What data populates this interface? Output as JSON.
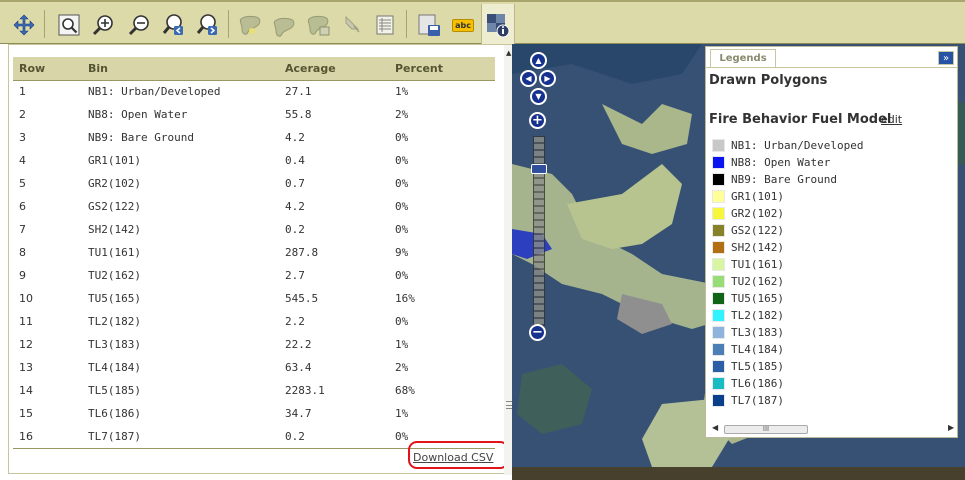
{
  "toolbar": {
    "buttons": [
      {
        "icon": "pan-arrows-icon"
      },
      {
        "icon": "zoom-extent-icon"
      },
      {
        "icon": "zoom-in-icon"
      },
      {
        "icon": "zoom-out-icon"
      },
      {
        "icon": "zoom-previous-icon"
      },
      {
        "icon": "zoom-next-icon"
      },
      {
        "icon": "draw-polygon-icon"
      },
      {
        "icon": "edit-polygon-icon"
      },
      {
        "icon": "polygon-table-icon"
      },
      {
        "icon": "select-arrow-icon"
      },
      {
        "icon": "attribute-table-icon"
      },
      {
        "icon": "save-map-icon"
      },
      {
        "icon": "label-abc-icon"
      },
      {
        "icon": "map-info-icon"
      }
    ],
    "label_icon_text": "abc"
  },
  "table": {
    "headers": [
      "Row",
      "Bin",
      "Acerage",
      "Percent"
    ],
    "rows": [
      {
        "row": "1",
        "bin": "NB1: Urban/Developed",
        "acreage": "27.1",
        "percent": "1%"
      },
      {
        "row": "2",
        "bin": "NB8: Open Water",
        "acreage": "55.8",
        "percent": "2%"
      },
      {
        "row": "3",
        "bin": "NB9: Bare Ground",
        "acreage": "4.2",
        "percent": "0%"
      },
      {
        "row": "4",
        "bin": "GR1(101)",
        "acreage": "0.4",
        "percent": "0%"
      },
      {
        "row": "5",
        "bin": "GR2(102)",
        "acreage": "0.7",
        "percent": "0%"
      },
      {
        "row": "6",
        "bin": "GS2(122)",
        "acreage": "4.2",
        "percent": "0%"
      },
      {
        "row": "7",
        "bin": "SH2(142)",
        "acreage": "0.2",
        "percent": "0%"
      },
      {
        "row": "8",
        "bin": "TU1(161)",
        "acreage": "287.8",
        "percent": "9%"
      },
      {
        "row": "9",
        "bin": "TU2(162)",
        "acreage": "2.7",
        "percent": "0%"
      },
      {
        "row": "10",
        "bin": "TU5(165)",
        "acreage": "545.5",
        "percent": "16%"
      },
      {
        "row": "11",
        "bin": "TL2(182)",
        "acreage": "2.2",
        "percent": "0%"
      },
      {
        "row": "12",
        "bin": "TL3(183)",
        "acreage": "22.2",
        "percent": "1%"
      },
      {
        "row": "13",
        "bin": "TL4(184)",
        "acreage": "63.4",
        "percent": "2%"
      },
      {
        "row": "14",
        "bin": "TL5(185)",
        "acreage": "2283.1",
        "percent": "68%"
      },
      {
        "row": "15",
        "bin": "TL6(186)",
        "acreage": "34.7",
        "percent": "1%"
      },
      {
        "row": "16",
        "bin": "TL7(187)",
        "acreage": "0.2",
        "percent": "0%"
      }
    ],
    "download_label": "Download CSV"
  },
  "map": {
    "pan_up_glyph": "▲",
    "pan_down_glyph": "▼",
    "pan_left_glyph": "◀",
    "pan_right_glyph": "▶",
    "zoom_in_glyph": "+",
    "zoom_out_glyph": "−"
  },
  "legend": {
    "tab_label": "Legends",
    "collapse_glyph": "»",
    "drawn_polygons_title": "Drawn Polygons",
    "fuel_model_title": "Fire Behavior Fuel Model",
    "edit_label": "edit",
    "scroll_thumb_glyph": "III",
    "scroll_left_glyph": "◀",
    "scroll_right_glyph": "▶",
    "items": [
      {
        "label": "NB1: Urban/Developed",
        "color": "#c8c8c8"
      },
      {
        "label": "NB8: Open Water",
        "color": "#0a14f0"
      },
      {
        "label": "NB9: Bare Ground",
        "color": "#000000"
      },
      {
        "label": "GR1(101)",
        "color": "#ffff9a"
      },
      {
        "label": "GR2(102)",
        "color": "#f6f63a"
      },
      {
        "label": "GS2(122)",
        "color": "#878228"
      },
      {
        "label": "SH2(142)",
        "color": "#b26f12"
      },
      {
        "label": "TU1(161)",
        "color": "#d8f5a2"
      },
      {
        "label": "TU2(162)",
        "color": "#98dc75"
      },
      {
        "label": "TU5(165)",
        "color": "#0f6415"
      },
      {
        "label": "TL2(182)",
        "color": "#2ff4ff"
      },
      {
        "label": "TL3(183)",
        "color": "#8eb4dd"
      },
      {
        "label": "TL4(184)",
        "color": "#4b7fb6"
      },
      {
        "label": "TL5(185)",
        "color": "#2b5ea4"
      },
      {
        "label": "TL6(186)",
        "color": "#19bcc3"
      },
      {
        "label": "TL7(187)",
        "color": "#0a3f8a"
      }
    ]
  }
}
